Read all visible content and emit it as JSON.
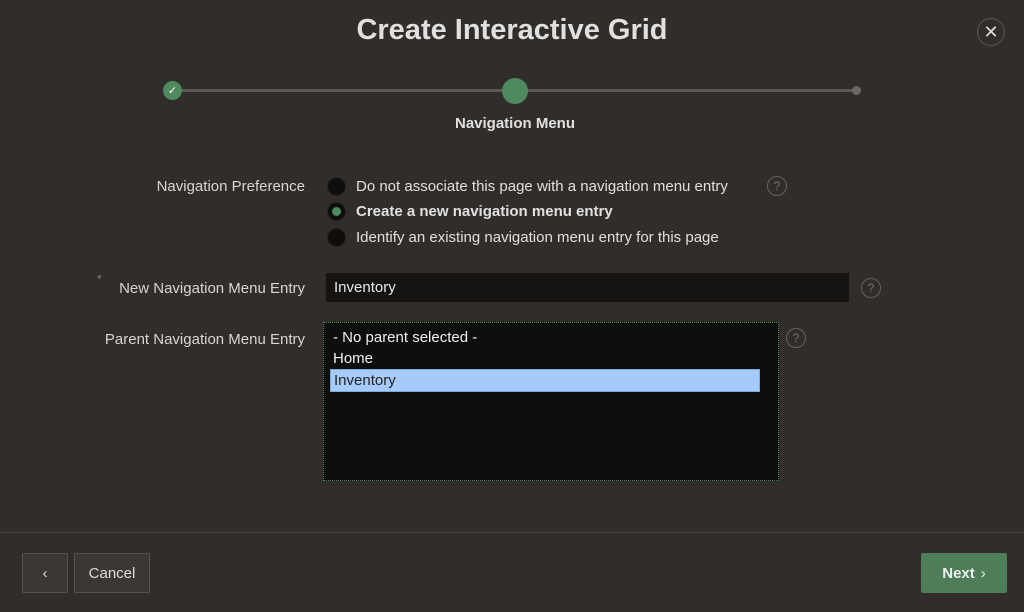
{
  "dialog": {
    "title": "Create Interactive Grid",
    "close_icon": "close-icon"
  },
  "wizard": {
    "steps": [
      {
        "state": "complete",
        "icon": "check-icon"
      },
      {
        "state": "current"
      },
      {
        "state": "upcoming"
      }
    ],
    "current_step_label": "Navigation Menu"
  },
  "form": {
    "navigation_preference": {
      "label": "Navigation Preference",
      "options": [
        {
          "label": "Do not associate this page with a navigation menu entry",
          "selected": false
        },
        {
          "label": "Create a new navigation menu entry",
          "selected": true
        },
        {
          "label": "Identify an existing navigation menu entry for this page",
          "selected": false
        }
      ]
    },
    "new_entry": {
      "label": "New Navigation Menu Entry",
      "required_mark": "*",
      "value": "Inventory"
    },
    "parent_entry": {
      "label": "Parent Navigation Menu Entry",
      "options": [
        "- No parent selected -",
        "Home",
        "Inventory"
      ],
      "selected": "Inventory"
    },
    "help_glyph": "?"
  },
  "footer": {
    "back_label": "‹",
    "cancel_label": "Cancel",
    "next_label": "Next",
    "next_chevron": "›"
  },
  "colors": {
    "accent": "#4e8a5e",
    "background": "#312d2a",
    "selection": "#a6cbfb"
  }
}
